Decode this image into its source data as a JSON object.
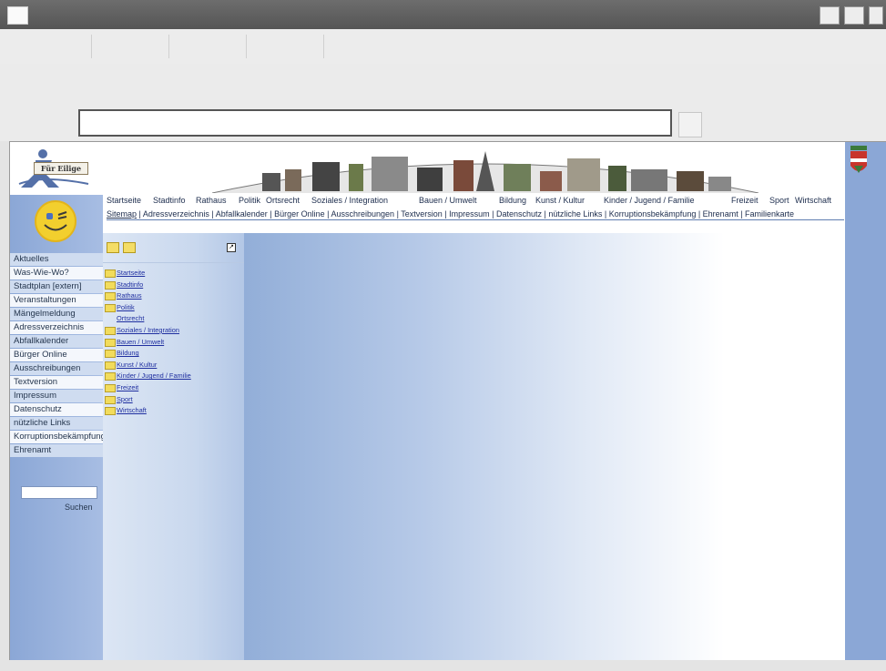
{
  "header": {
    "top_nav": [
      "Startseite",
      "Stadtinfo",
      "Rathaus",
      "Politik",
      "Ortsrecht",
      "Soziales / Integration",
      "Bauen / Umwelt",
      "Bildung",
      "Kunst / Kultur",
      "Kinder / Jugend / Familie",
      "Freizeit",
      "Sport",
      "Wirtschaft"
    ],
    "sub_nav": [
      "Sitemap",
      "Adressverzeichnis",
      "Abfallkalender",
      "Bürger Online",
      "Ausschreibungen",
      "Textversion",
      "Impressum",
      "Datenschutz",
      "nützliche Links",
      "Korruptionsbekämpfung",
      "Ehrenamt",
      "Familienkarte"
    ],
    "active_sub": "Sitemap"
  },
  "logo": {
    "label": "Für Eilige"
  },
  "sidebar": {
    "items": [
      "Aktuelles",
      "Was-Wie-Wo?",
      "Stadtplan [extern]",
      "Veranstaltungen",
      "Mängelmeldung",
      "Adressverzeichnis",
      "Abfallkalender",
      "Bürger Online",
      "Ausschreibungen",
      "Textversion",
      "Impressum",
      "Datenschutz",
      "nützliche Links",
      "Korruptionsbekämpfung",
      "Ehrenamt"
    ],
    "search_label": "Suchen"
  },
  "sitemap": {
    "tree": [
      {
        "label": "Startseite",
        "icon": "folder-icon"
      },
      {
        "label": "Stadtinfo",
        "icon": "folder-icon"
      },
      {
        "label": "Rathaus",
        "icon": "folder-icon"
      },
      {
        "label": "Politik",
        "icon": "folder-icon"
      },
      {
        "label": "Ortsrecht",
        "icon": "page-icon"
      },
      {
        "label": "Soziales / Integration",
        "icon": "folder-icon"
      },
      {
        "label": "Bauen / Umwelt",
        "icon": "folder-icon"
      },
      {
        "label": "Bildung",
        "icon": "folder-icon"
      },
      {
        "label": "Kunst / Kultur",
        "icon": "folder-icon"
      },
      {
        "label": "Kinder / Jugend / Familie",
        "icon": "folder-icon"
      },
      {
        "label": "Freizeit",
        "icon": "folder-icon"
      },
      {
        "label": "Sport",
        "icon": "folder-icon"
      },
      {
        "label": "Wirtschaft",
        "icon": "folder-icon"
      }
    ]
  },
  "colors": {
    "sidebar_blue": "#8ba7d6",
    "link_blue": "#1f2fa0",
    "smiley_yellow": "#f2cf2e",
    "titlebar": "#5c5c5c"
  }
}
